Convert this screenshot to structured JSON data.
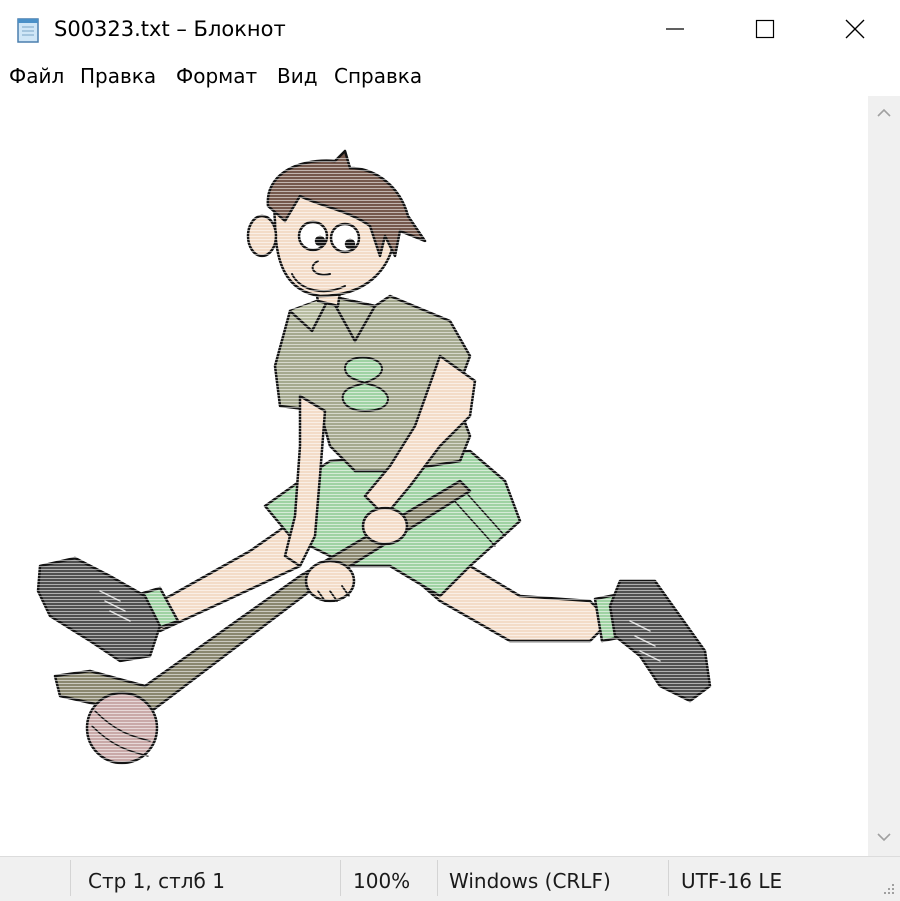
{
  "window": {
    "title": "S00323.txt – Блокнот",
    "icon": "notepad-icon",
    "controls": [
      "minimize-icon",
      "maximize-icon",
      "close-icon"
    ]
  },
  "menu": {
    "items": [
      "Файл",
      "Правка",
      "Формат",
      "Вид",
      "Справка"
    ]
  },
  "editor": {
    "content_description": "ASCII-art style cartoon of a field hockey player in number 8 shirt swinging a stick at a ball",
    "shirt_number": "8"
  },
  "status": {
    "position": "Стр 1, стлб 1",
    "zoom": "100%",
    "line_endings": "Windows (CRLF)",
    "encoding": "UTF-16 LE"
  },
  "colors": {
    "skin": "#f3dcc8",
    "shirt": "#a5a98f",
    "shorts": "#9fd2a3",
    "hair": "#75584c",
    "stick": "#8a876f",
    "shoes": "#505050",
    "outline": "#141414"
  }
}
